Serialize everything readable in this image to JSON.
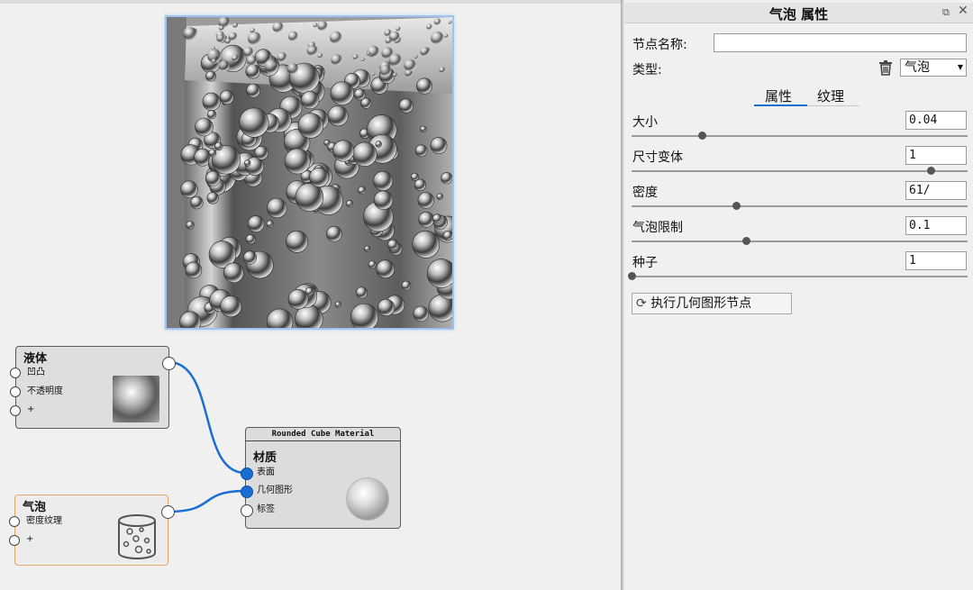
{
  "editor": {
    "nodes": {
      "liquid": {
        "title": "液体",
        "inputs": [
          "凹凸",
          "不透明度",
          "+"
        ]
      },
      "bubble": {
        "title": "气泡",
        "inputs": [
          "密度纹理",
          "+"
        ]
      },
      "material": {
        "header": "Rounded Cube Material",
        "title": "材质",
        "inputs": [
          "表面",
          "几何图形",
          "标签"
        ]
      }
    }
  },
  "panel": {
    "title": "气泡 属性",
    "node_name_label": "节点名称:",
    "node_name_value": "",
    "type_label": "类型:",
    "type_value": "气泡",
    "tabs": [
      "属性",
      "纹理"
    ],
    "active_tab": "属性",
    "params": [
      {
        "label": "大小",
        "value": "0.04",
        "level": 0.21
      },
      {
        "label": "尺寸变体",
        "value": "1",
        "level": 0.89
      },
      {
        "label": "密度",
        "value": "61/",
        "level": 0.31
      },
      {
        "label": "气泡限制",
        "value": "0.1",
        "level": 0.34
      },
      {
        "label": "种子",
        "value": "1",
        "level": 0.0
      }
    ],
    "exec_button": "执行几何图形节点"
  },
  "colors": {
    "accent": "#1a6ed1",
    "bubble_node_border": "#e8a66a",
    "background": "#f0f0f0"
  },
  "icons": [
    "trash-icon",
    "dropdown-arrow-icon",
    "refresh-icon",
    "float-window-icon",
    "close-icon"
  ]
}
